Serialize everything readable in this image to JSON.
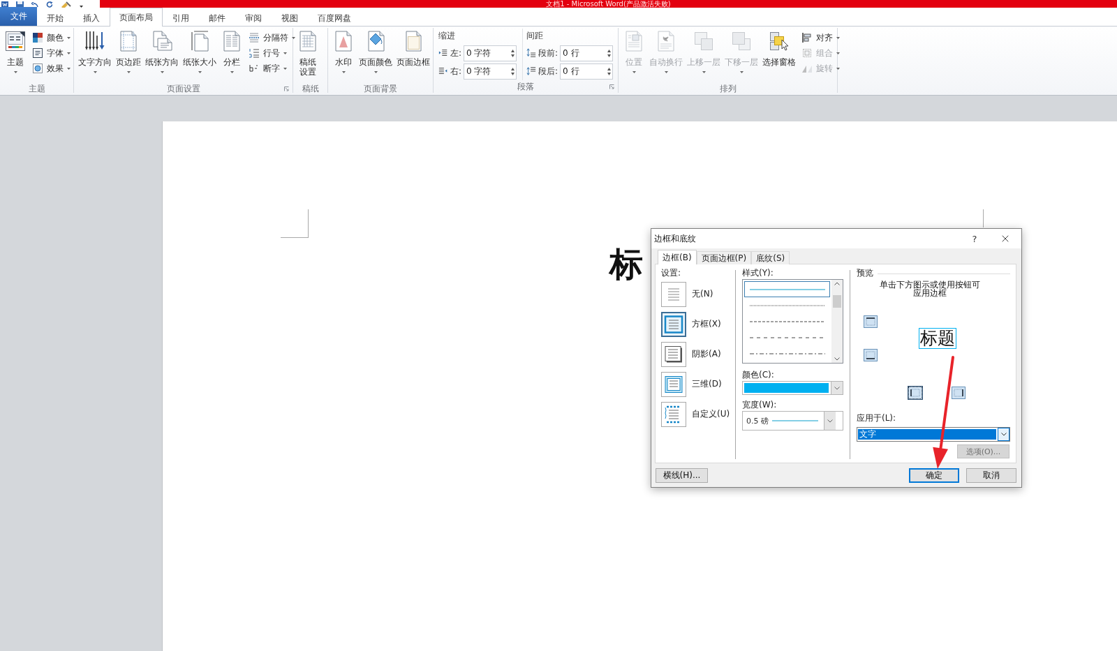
{
  "window": {
    "title": "文档1 - Microsoft Word(产品激活失败)"
  },
  "ribbon_tabs": [
    {
      "label": "文件",
      "kind": "file",
      "selected": false
    },
    {
      "label": "开始",
      "kind": "tab",
      "selected": false
    },
    {
      "label": "插入",
      "kind": "tab",
      "selected": false
    },
    {
      "label": "页面布局",
      "kind": "tab",
      "selected": true
    },
    {
      "label": "引用",
      "kind": "tab",
      "selected": false
    },
    {
      "label": "邮件",
      "kind": "tab",
      "selected": false
    },
    {
      "label": "审阅",
      "kind": "tab",
      "selected": false
    },
    {
      "label": "视图",
      "kind": "tab",
      "selected": false
    },
    {
      "label": "百度网盘",
      "kind": "tab",
      "selected": false
    }
  ],
  "ribbon_groups": [
    {
      "label": "主题",
      "launcher": false,
      "items": [
        {
          "kind": "large",
          "label": "主题",
          "dropdown": true,
          "disabled": false
        },
        {
          "kind": "stack",
          "items": [
            {
              "label": "颜色",
              "dropdown": true,
              "disabled": false
            },
            {
              "label": "字体",
              "dropdown": true,
              "disabled": false
            },
            {
              "label": "效果",
              "dropdown": true,
              "disabled": false
            }
          ]
        }
      ]
    },
    {
      "label": "页面设置",
      "launcher": true,
      "items": [
        {
          "kind": "large",
          "label": "文字方向",
          "dropdown": true,
          "disabled": false
        },
        {
          "kind": "large",
          "label": "页边距",
          "dropdown": true,
          "disabled": false
        },
        {
          "kind": "large",
          "label": "纸张方向",
          "dropdown": true,
          "disabled": false
        },
        {
          "kind": "large",
          "label": "纸张大小",
          "dropdown": true,
          "disabled": false
        },
        {
          "kind": "large",
          "label": "分栏",
          "dropdown": true,
          "disabled": false
        },
        {
          "kind": "stack",
          "items": [
            {
              "label": "分隔符",
              "dropdown": true,
              "disabled": false
            },
            {
              "label": "行号",
              "dropdown": true,
              "disabled": false
            },
            {
              "label": "断字",
              "dropdown": true,
              "disabled": false
            }
          ]
        }
      ]
    },
    {
      "label": "稿纸",
      "launcher": false,
      "items": [
        {
          "kind": "large",
          "label": "稿纸设置",
          "dropdown": false,
          "disabled": false
        }
      ]
    },
    {
      "label": "页面背景",
      "launcher": false,
      "items": [
        {
          "kind": "large",
          "label": "水印",
          "dropdown": true,
          "disabled": false
        },
        {
          "kind": "large",
          "label": "页面颜色",
          "dropdown": true,
          "disabled": false
        },
        {
          "kind": "large",
          "label": "页面边框",
          "dropdown": false,
          "disabled": false
        }
      ]
    },
    {
      "label": "段落",
      "launcher": true,
      "items": [
        {
          "kind": "fields",
          "heading": "缩进",
          "fields": [
            {
              "label": "左:",
              "value": "0 字符"
            },
            {
              "label": "右:",
              "value": "0 字符"
            }
          ]
        },
        {
          "kind": "fields",
          "heading": "间距",
          "fields": [
            {
              "label": "段前:",
              "value": "0 行"
            },
            {
              "label": "段后:",
              "value": "0 行"
            }
          ]
        }
      ]
    },
    {
      "label": "排列",
      "launcher": false,
      "items": [
        {
          "kind": "large",
          "label": "位置",
          "dropdown": true,
          "disabled": true
        },
        {
          "kind": "large",
          "label": "自动换行",
          "dropdown": true,
          "disabled": true
        },
        {
          "kind": "large",
          "label": "上移一层",
          "dropdown": true,
          "disabled": true
        },
        {
          "kind": "large",
          "label": "下移一层",
          "dropdown": true,
          "disabled": true
        },
        {
          "kind": "large",
          "label": "选择窗格",
          "dropdown": false,
          "disabled": false
        },
        {
          "kind": "stack",
          "items": [
            {
              "label": "对齐",
              "dropdown": true,
              "disabled": false
            },
            {
              "label": "组合",
              "dropdown": true,
              "disabled": true
            },
            {
              "label": "旋转",
              "dropdown": true,
              "disabled": true
            }
          ]
        }
      ]
    }
  ],
  "document": {
    "heading": "标"
  },
  "dialog": {
    "title": "边框和底纹",
    "help": "?",
    "tabs": [
      {
        "label": "边框(B)",
        "selected": true
      },
      {
        "label": "页面边框(P)",
        "selected": false
      },
      {
        "label": "底纹(S)",
        "selected": false
      }
    ],
    "settings": {
      "label": "设置:",
      "items": [
        {
          "label": "无(N)",
          "kind": "none",
          "selected": false
        },
        {
          "label": "方框(X)",
          "kind": "box",
          "selected": true
        },
        {
          "label": "阴影(A)",
          "kind": "shadow",
          "selected": false
        },
        {
          "label": "三维(D)",
          "kind": "raised",
          "selected": false
        },
        {
          "label": "自定义(U)",
          "kind": "custom",
          "selected": false
        }
      ]
    },
    "style": {
      "label": "样式(Y):",
      "options": [
        {
          "kind": "solid",
          "selected": true
        },
        {
          "kind": "dotted",
          "selected": false
        },
        {
          "kind": "dashed",
          "selected": false
        },
        {
          "kind": "spaced",
          "selected": false
        },
        {
          "kind": "dashdot",
          "selected": false
        }
      ]
    },
    "color": {
      "label": "颜色(C):",
      "color": "#00b0f0"
    },
    "width": {
      "label": "宽度(W):",
      "value": "0.5 磅"
    },
    "preview": {
      "label": "预览",
      "hint": "单击下方图示或使用按钮可应用边框",
      "sample": "标题",
      "border_buttons": [
        {
          "kind": "top",
          "focused": false
        },
        {
          "kind": "bottom",
          "focused": false
        },
        {
          "kind": "left",
          "focused": true
        },
        {
          "kind": "right",
          "focused": false
        }
      ]
    },
    "apply_to": {
      "label": "应用于(L):",
      "value": "文字"
    },
    "options_button": {
      "label": "选项(O)...",
      "disabled": true
    },
    "horizontal_line_button": {
      "label": "横线(H)..."
    },
    "buttons": [
      {
        "label": "确定",
        "default": true
      },
      {
        "label": "取消",
        "default": false
      }
    ]
  }
}
